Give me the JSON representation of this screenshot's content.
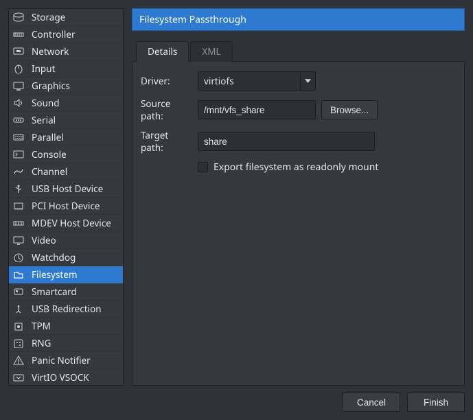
{
  "sidebar": {
    "items": [
      {
        "label": "Storage",
        "icon": "disk"
      },
      {
        "label": "Controller",
        "icon": "controller"
      },
      {
        "label": "Network",
        "icon": "network"
      },
      {
        "label": "Input",
        "icon": "input"
      },
      {
        "label": "Graphics",
        "icon": "display"
      },
      {
        "label": "Sound",
        "icon": "sound"
      },
      {
        "label": "Serial",
        "icon": "serial"
      },
      {
        "label": "Parallel",
        "icon": "parallel"
      },
      {
        "label": "Console",
        "icon": "console"
      },
      {
        "label": "Channel",
        "icon": "channel"
      },
      {
        "label": "USB Host Device",
        "icon": "usb"
      },
      {
        "label": "PCI Host Device",
        "icon": "pci"
      },
      {
        "label": "MDEV Host Device",
        "icon": "mdev"
      },
      {
        "label": "Video",
        "icon": "video"
      },
      {
        "label": "Watchdog",
        "icon": "watchdog"
      },
      {
        "label": "Filesystem",
        "icon": "filesystem",
        "selected": true
      },
      {
        "label": "Smartcard",
        "icon": "smartcard"
      },
      {
        "label": "USB Redirection",
        "icon": "usb-redir"
      },
      {
        "label": "TPM",
        "icon": "tpm"
      },
      {
        "label": "RNG",
        "icon": "rng"
      },
      {
        "label": "Panic Notifier",
        "icon": "panic"
      },
      {
        "label": "VirtIO VSOCK",
        "icon": "vsock"
      }
    ]
  },
  "panel": {
    "title": "Filesystem Passthrough",
    "tabs": {
      "details": "Details",
      "xml": "XML"
    },
    "form": {
      "driver_label": "Driver:",
      "driver_value": "virtiofs",
      "source_label": "Source path:",
      "source_value": "/mnt/vfs_share",
      "browse_label": "Browse...",
      "target_label": "Target path:",
      "target_value": "share",
      "readonly_label": "Export filesystem as readonly mount",
      "readonly_checked": false
    }
  },
  "footer": {
    "cancel": "Cancel",
    "finish": "Finish"
  }
}
